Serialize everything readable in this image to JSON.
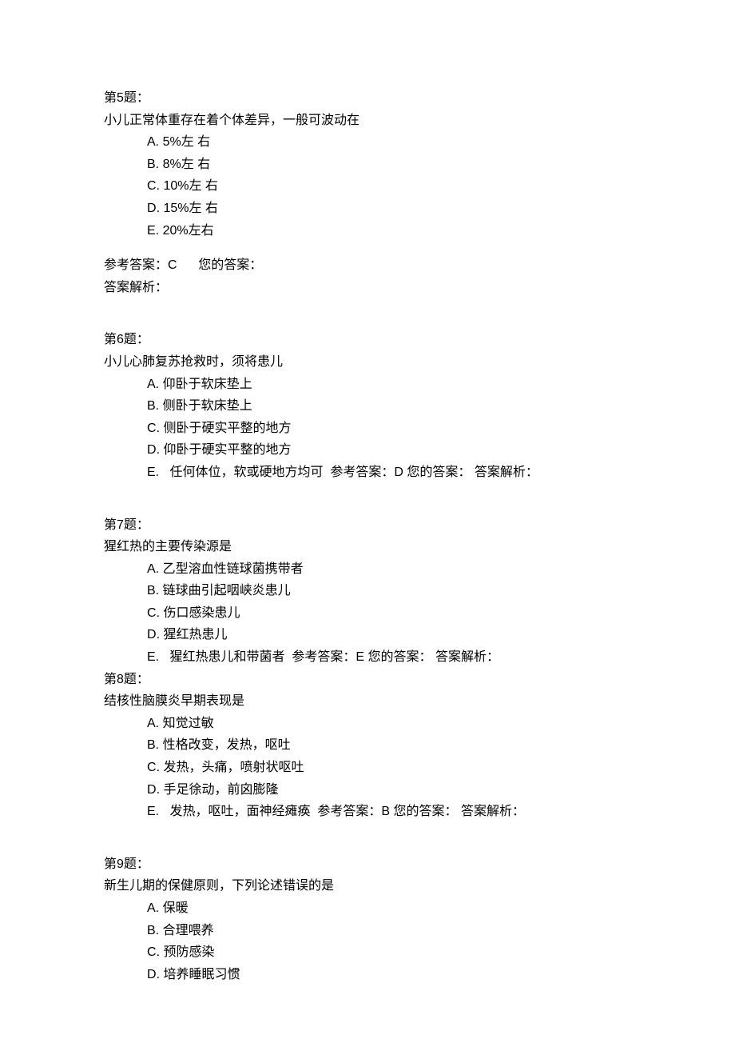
{
  "labels": {
    "ref_answer_prefix": "参考答案：",
    "your_answer_label": "您的答案：",
    "explain_label": "答案解析："
  },
  "questions": [
    {
      "header": "第5题：",
      "stem": "小儿正常体重存在着个体差异，一般可波动在",
      "options": [
        {
          "letter": "A",
          "text": "5%左  右"
        },
        {
          "letter": "B",
          "text": "8%左  右"
        },
        {
          "letter": "C",
          "text": "10%左  右"
        },
        {
          "letter": "D",
          "text": "15%左  右"
        },
        {
          "letter": "E",
          "text": "20%左右"
        }
      ],
      "ref_answer": "C",
      "inline_answer": false
    },
    {
      "header": "第6题：",
      "stem": "小儿心肺复苏抢救时，须将患儿",
      "options": [
        {
          "letter": "A",
          "text": "仰卧于软床垫上"
        },
        {
          "letter": "B",
          "text": "侧卧于软床垫上"
        },
        {
          "letter": "C",
          "text": "侧卧于硬实平整的地方"
        },
        {
          "letter": "D",
          "text": "仰卧于硬实平整的地方"
        },
        {
          "letter": "E",
          "text": "任何体位，软或硬地方均可"
        }
      ],
      "ref_answer": "D",
      "inline_answer": true
    },
    {
      "header": "第7题：",
      "stem": "猩红热的主要传染源是",
      "options": [
        {
          "letter": "A",
          "text": "乙型溶血性链球菌携带者"
        },
        {
          "letter": "B",
          "text": "链球曲引起咽峡炎患儿"
        },
        {
          "letter": "C",
          "text": "伤口感染患儿"
        },
        {
          "letter": "D",
          "text": "猩红热患儿"
        },
        {
          "letter": "E",
          "text": "猩红热患儿和带菌者"
        }
      ],
      "ref_answer": "E",
      "inline_answer": true
    },
    {
      "header": "第8题：",
      "stem": "结核性脑膜炎早期表现是",
      "options": [
        {
          "letter": "A",
          "text": "知觉过敏"
        },
        {
          "letter": "B",
          "text": "性格改变，发热，呕吐"
        },
        {
          "letter": "C",
          "text": "发热，头痛，喷射状呕吐"
        },
        {
          "letter": "D",
          "text": "手足徐动，前囟膨隆"
        },
        {
          "letter": "E",
          "text": "发热，呕吐，面神经瘫痪"
        }
      ],
      "ref_answer": "B",
      "inline_answer": true
    },
    {
      "header": "第9题：",
      "stem": "新生儿期的保健原则，下列论述错误的是",
      "options": [
        {
          "letter": "A",
          "text": "保暖"
        },
        {
          "letter": "B",
          "text": "合理喂养"
        },
        {
          "letter": "C",
          "text": "预防感染"
        },
        {
          "letter": "D",
          "text": "培养睡眠习惯"
        }
      ],
      "ref_answer": "",
      "inline_answer": false,
      "hide_answer": true
    }
  ]
}
